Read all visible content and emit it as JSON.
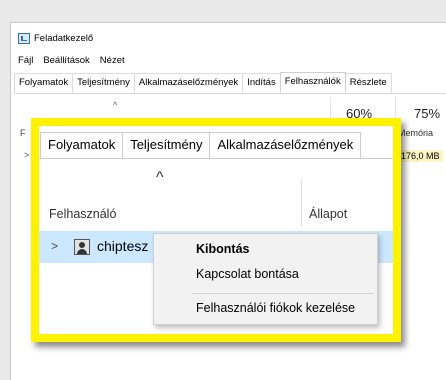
{
  "window": {
    "title": "Feladatkezelő",
    "menu": [
      "Fájl",
      "Beállítások",
      "Nézet"
    ]
  },
  "background_tabs": [
    "Folyamatok",
    "Teljesítmény",
    "Alkalmazáselőzmények",
    "Indítás",
    "Felhasználók",
    "Részlete"
  ],
  "background": {
    "cpu_pct": "60%",
    "mem_pct": "75%",
    "mem_label": "Memória",
    "mem_value": "176,0 MB",
    "partial_col": "F",
    "partial_arrow": ">",
    "sort_glyph": "^"
  },
  "highlight": {
    "tabs": [
      "Folyamatok",
      "Teljesítmény",
      "Alkalmazáselőzmények"
    ],
    "sort_glyph": "^",
    "columns": {
      "user": "Felhasználó",
      "state": "Állapot"
    },
    "row": {
      "expand_glyph": ">",
      "user_name": "chiptesz"
    }
  },
  "context_menu": {
    "items": [
      "Kibontás",
      "Kapcsolat bontása",
      "Felhasználói fiókok kezelése"
    ]
  },
  "colors": {
    "highlight_frame": "#fff200",
    "selected_row": "#cce8ff"
  },
  "icons": [
    "task-manager-icon",
    "user-icon",
    "chevron-up-icon",
    "chevron-right-icon"
  ]
}
